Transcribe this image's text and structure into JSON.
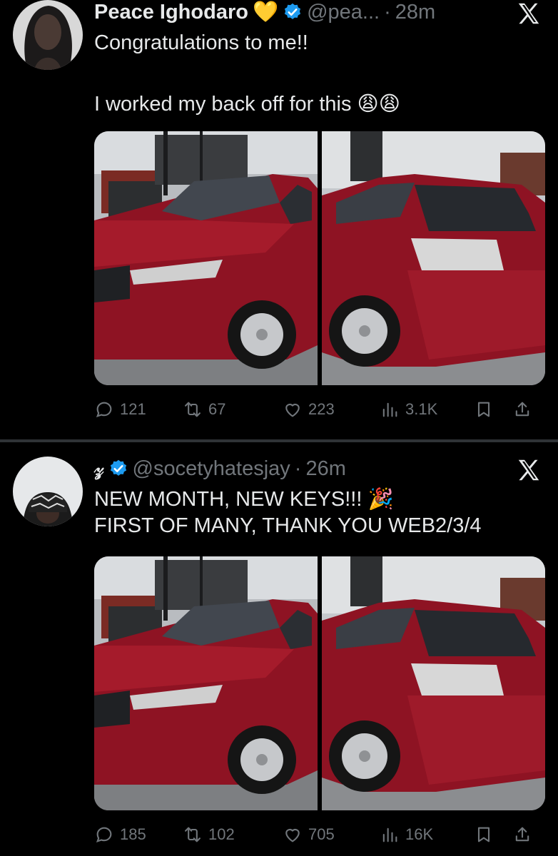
{
  "tweets": [
    {
      "author": {
        "name": "Peace Ighodaro",
        "name_emoji": "💛",
        "handle": "@pea...",
        "avatar": "woman-portrait-avatar",
        "verified": true
      },
      "time": "28m",
      "separator": "·",
      "text_lines": [
        "Congratulations to me!!",
        "",
        "I worked my back off for this 😩😩"
      ],
      "media": [
        "red-lexus-front-photo",
        "red-lexus-rear-photo"
      ],
      "stats": {
        "replies": "121",
        "reposts": "67",
        "likes": "223",
        "views": "3.1K"
      }
    },
    {
      "author": {
        "name": "𝓏",
        "handle": "@socetyhatesjay",
        "avatar": "man-cap-avatar",
        "verified": true
      },
      "time": "26m",
      "separator": "·",
      "text_lines": [
        "NEW MONTH, NEW KEYS!!! 🎉",
        "FIRST OF MANY, THANK YOU WEB2/3/4"
      ],
      "media": [
        "red-lexus-front-photo",
        "red-lexus-rear-photo"
      ],
      "stats": {
        "replies": "185",
        "reposts": "102",
        "likes": "705",
        "views": "16K"
      }
    }
  ],
  "colors": {
    "background": "#000000",
    "text": "#e7e9ea",
    "muted": "#71767b",
    "verified": "#1d9bf0",
    "car": "#8e1323"
  },
  "icons": [
    "x-logo-icon",
    "verified-badge-icon",
    "reply-icon",
    "repost-icon",
    "like-icon",
    "views-icon",
    "bookmark-icon",
    "share-icon"
  ]
}
